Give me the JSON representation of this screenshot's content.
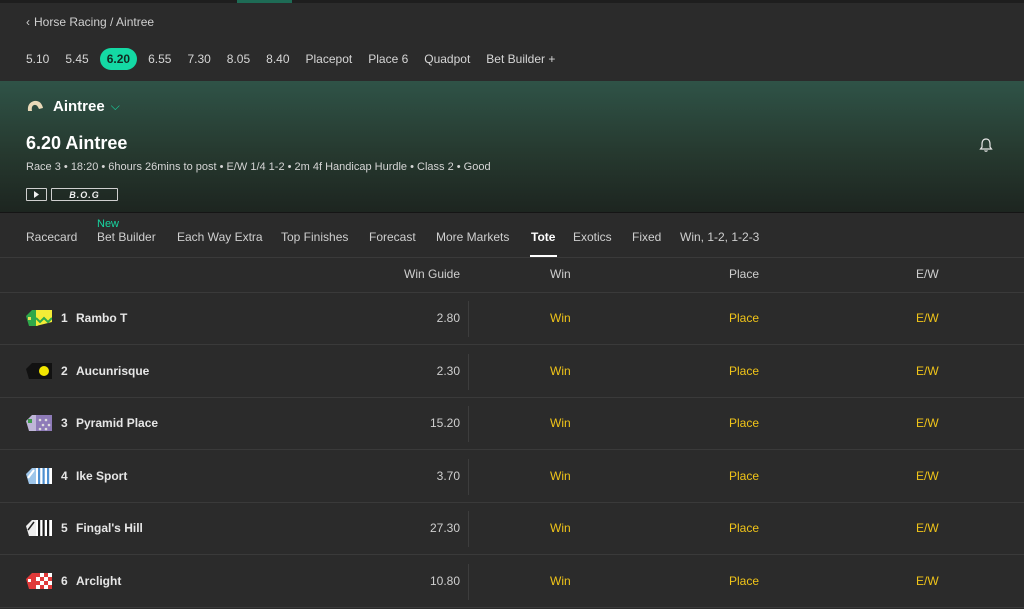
{
  "breadcrumb": "Horse Racing / Aintree",
  "race_times": [
    {
      "label": "5.10",
      "active": false
    },
    {
      "label": "5.45",
      "active": false
    },
    {
      "label": "6.20",
      "active": true
    },
    {
      "label": "6.55",
      "active": false
    },
    {
      "label": "7.30",
      "active": false
    },
    {
      "label": "8.05",
      "active": false
    },
    {
      "label": "8.40",
      "active": false
    },
    {
      "label": "Placepot",
      "active": false
    },
    {
      "label": "Place 6",
      "active": false
    },
    {
      "label": "Quadpot",
      "active": false
    },
    {
      "label": "Bet Builder +",
      "active": false
    }
  ],
  "hero": {
    "venue": "Aintree",
    "title": "6.20 Aintree",
    "meta": "Race 3 • 18:20 • 6hours 26mins to post • E/W 1/4 1-2 • 2m 4f Handicap Hurdle • Class 2 • Good",
    "bog_label": "B.O.G",
    "colors": {
      "gradient_top": "#2f5347",
      "gradient_bottom": "#1d2520"
    }
  },
  "market_tabs": {
    "new_label": "New",
    "tabs": [
      {
        "label": "Racecard"
      },
      {
        "label": "Bet Builder"
      },
      {
        "label": "Each Way Extra"
      },
      {
        "label": "Top Finishes"
      },
      {
        "label": "Forecast"
      },
      {
        "label": "More Markets"
      },
      {
        "label": "Tote",
        "active": true
      },
      {
        "label": "Exotics"
      },
      {
        "label": "Fixed"
      },
      {
        "label": "Win, 1-2, 1-2-3"
      }
    ]
  },
  "table": {
    "headers": {
      "guide": "Win Guide",
      "win": "Win",
      "place": "Place",
      "ew": "E/W"
    },
    "rows": [
      {
        "num": "1",
        "horse": "Rambo T",
        "guide": "2.80",
        "win": "Win",
        "place": "Place",
        "ew": "E/W",
        "silks": "yellow-green-silks-icon"
      },
      {
        "num": "2",
        "horse": "Aucunrisque",
        "guide": "2.30",
        "win": "Win",
        "place": "Place",
        "ew": "E/W",
        "silks": "black-yellow-silks-icon"
      },
      {
        "num": "3",
        "horse": "Pyramid Place",
        "guide": "15.20",
        "win": "Win",
        "place": "Place",
        "ew": "E/W",
        "silks": "purple-green-silks-icon"
      },
      {
        "num": "4",
        "horse": "Ike Sport",
        "guide": "3.70",
        "win": "Win",
        "place": "Place",
        "ew": "E/W",
        "silks": "blue-white-striped-silks-icon"
      },
      {
        "num": "5",
        "horse": "Fingal's Hill",
        "guide": "27.30",
        "win": "Win",
        "place": "Place",
        "ew": "E/W",
        "silks": "black-white-striped-silks-icon"
      },
      {
        "num": "6",
        "horse": "Arclight",
        "guide": "10.80",
        "win": "Win",
        "place": "Place",
        "ew": "E/W",
        "silks": "red-white-check-silks-icon"
      }
    ]
  },
  "colors": {
    "accent": "#14d9a4",
    "odds": "#f0c419",
    "background": "#2b2b2b"
  }
}
